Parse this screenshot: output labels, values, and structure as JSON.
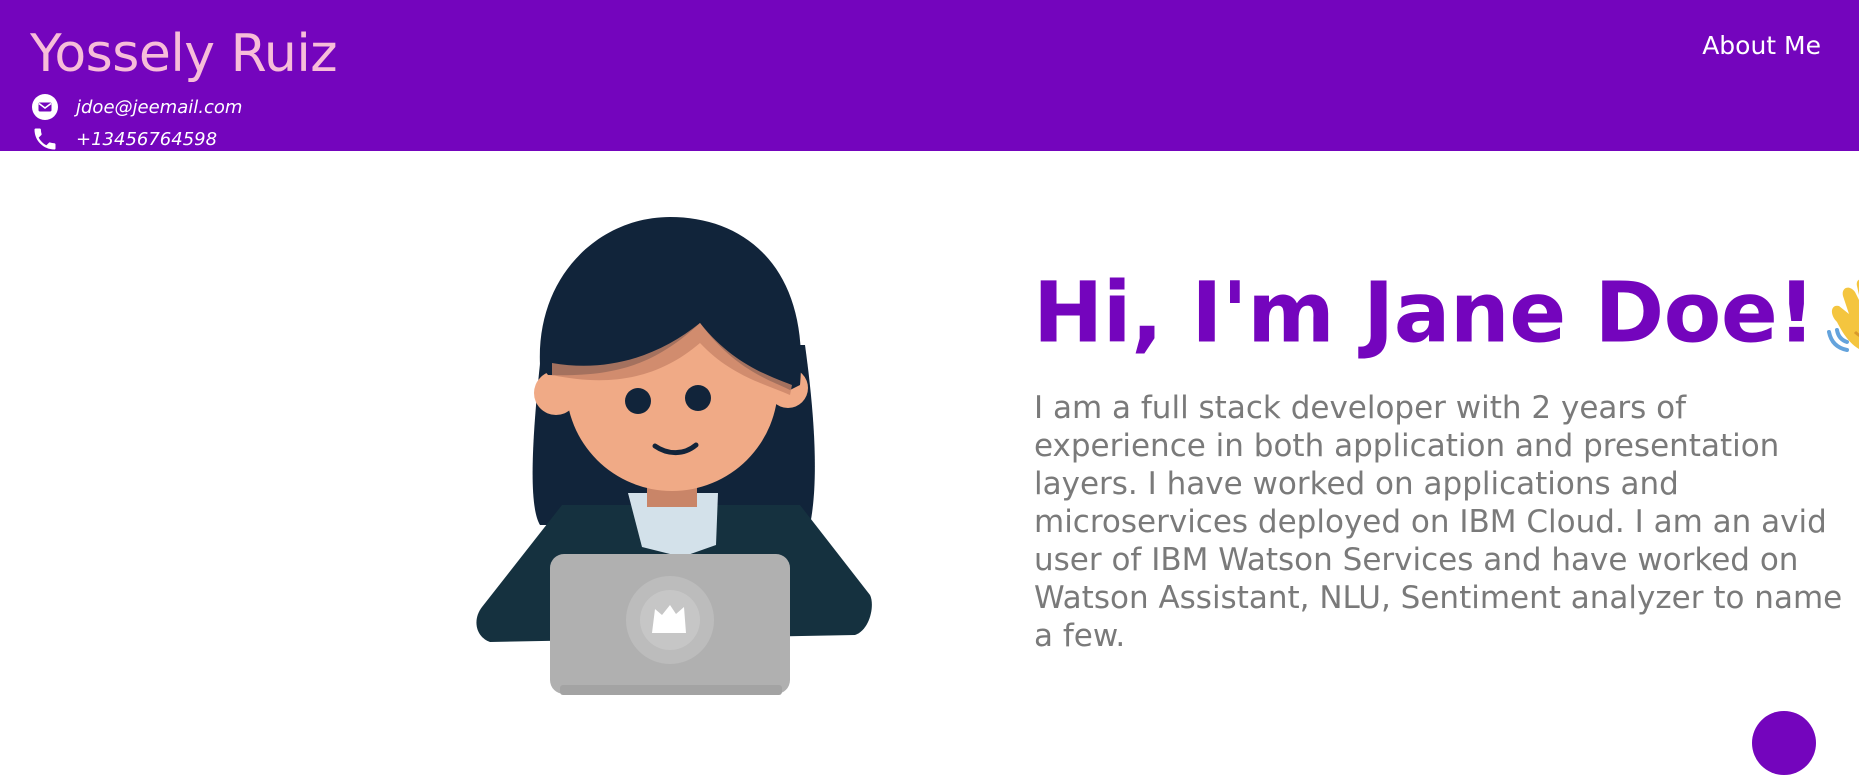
{
  "header": {
    "brand": "Yossely Ruiz",
    "email": "jdoe@jeemail.com",
    "phone": "+13456764598",
    "nav": [
      "About Me"
    ],
    "email_icon": "envelope-icon",
    "phone_icon": "phone-icon"
  },
  "hero": {
    "title": "Hi, I'm Jane Doe!",
    "title_emoji": "waving-hand-icon",
    "bio": "I am a full stack developer with 2 years of experience in both application and presentation layers. I have worked on applications and microservices deployed on IBM Cloud. I am an avid user of IBM Watson Services and have worked on Watson Assistant, NLU, Sentiment analyzer to name a few.",
    "illustration": "developer-avatar-illustration"
  },
  "colors": {
    "primary": "#7405bd",
    "brand_text": "#f7bdd9",
    "body_text": "#7a7a7a"
  }
}
